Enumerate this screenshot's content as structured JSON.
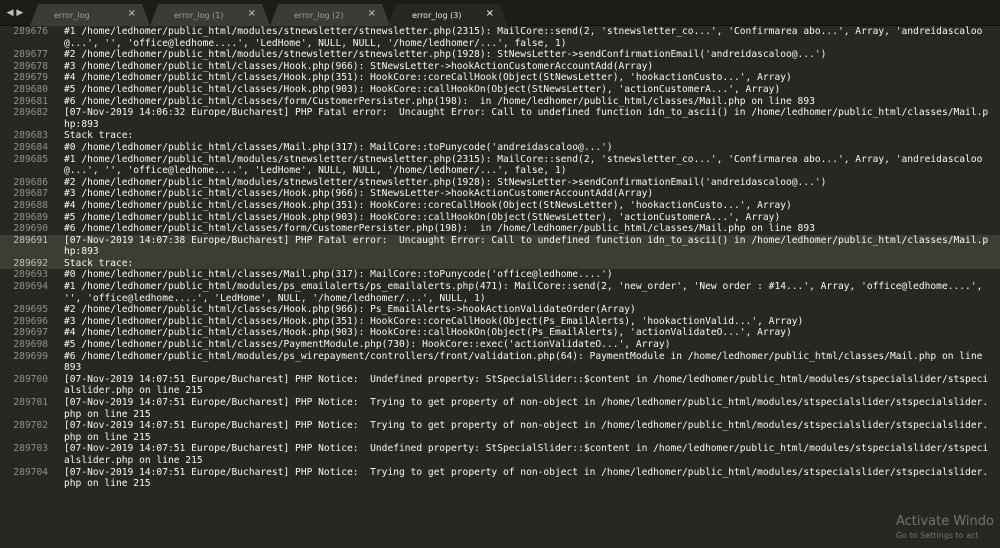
{
  "tabs": [
    {
      "label": "error_log",
      "active": false
    },
    {
      "label": "error_log (1)",
      "active": false
    },
    {
      "label": "error_log (2)",
      "active": false
    },
    {
      "label": "error_log (3)",
      "active": true
    }
  ],
  "tab_close_glyph": "×",
  "nav_arrows": "◀ ▶",
  "highlighted_line": "289691",
  "lines": [
    {
      "n": "289676",
      "text": "#1 /home/ledhomer/public_html/modules/stnewsletter/stnewsletter.php(2315): MailCore::send(2, 'stnewsletter_co...', 'Confirmarea abo...', Array, 'andreidascaloo@...', '', 'office@ledhome....', 'LedHome', NULL, NULL, '/home/ledhomer/...', false, 1)"
    },
    {
      "n": "289677",
      "text": "#2 /home/ledhomer/public_html/modules/stnewsletter/stnewsletter.php(1928): StNewsLetter->sendConfirmationEmail('andreidascaloo@...')"
    },
    {
      "n": "289678",
      "text": "#3 /home/ledhomer/public_html/classes/Hook.php(966): StNewsLetter->hookActionCustomerAccountAdd(Array)"
    },
    {
      "n": "289679",
      "text": "#4 /home/ledhomer/public_html/classes/Hook.php(351): HookCore::coreCallHook(Object(StNewsLetter), 'hookactionCusto...', Array)"
    },
    {
      "n": "289680",
      "text": "#5 /home/ledhomer/public_html/classes/Hook.php(903): HookCore::callHookOn(Object(StNewsLetter), 'actionCustomerA...', Array)"
    },
    {
      "n": "289681",
      "text": "#6 /home/ledhomer/public_html/classes/form/CustomerPersister.php(198):  in /home/ledhomer/public_html/classes/Mail.php on line 893"
    },
    {
      "n": "289682",
      "text": "[07-Nov-2019 14:06:32 Europe/Bucharest] PHP Fatal error:  Uncaught Error: Call to undefined function idn_to_ascii() in /home/ledhomer/public_html/classes/Mail.php:893"
    },
    {
      "n": "289683",
      "text": "Stack trace:"
    },
    {
      "n": "289684",
      "text": "#0 /home/ledhomer/public_html/classes/Mail.php(317): MailCore::toPunycode('andreidascaloo@...')"
    },
    {
      "n": "289685",
      "text": "#1 /home/ledhomer/public_html/modules/stnewsletter/stnewsletter.php(2315): MailCore::send(2, 'stnewsletter_co...', 'Confirmarea abo...', Array, 'andreidascaloo@...', '', 'office@ledhome....', 'LedHome', NULL, NULL, '/home/ledhomer/...', false, 1)"
    },
    {
      "n": "289686",
      "text": "#2 /home/ledhomer/public_html/modules/stnewsletter/stnewsletter.php(1928): StNewsLetter->sendConfirmationEmail('andreidascaloo@...')"
    },
    {
      "n": "289687",
      "text": "#3 /home/ledhomer/public_html/classes/Hook.php(966): StNewsLetter->hookActionCustomerAccountAdd(Array)"
    },
    {
      "n": "289688",
      "text": "#4 /home/ledhomer/public_html/classes/Hook.php(351): HookCore::coreCallHook(Object(StNewsLetter), 'hookactionCusto...', Array)"
    },
    {
      "n": "289689",
      "text": "#5 /home/ledhomer/public_html/classes/Hook.php(903): HookCore::callHookOn(Object(StNewsLetter), 'actionCustomerA...', Array)"
    },
    {
      "n": "289690",
      "text": "#6 /home/ledhomer/public_html/classes/form/CustomerPersister.php(198):  in /home/ledhomer/public_html/classes/Mail.php on line 893"
    },
    {
      "n": "289691",
      "text": "[07-Nov-2019 14:07:38 Europe/Bucharest] PHP Fatal error:  Uncaught Error: Call to undefined function idn_to_ascii() in /home/ledhomer/public_html/classes/Mail.php:893"
    },
    {
      "n": "289692",
      "text": "Stack trace:"
    },
    {
      "n": "289693",
      "text": "#0 /home/ledhomer/public_html/classes/Mail.php(317): MailCore::toPunycode('office@ledhome....')"
    },
    {
      "n": "289694",
      "text": "#1 /home/ledhomer/public_html/modules/ps_emailalerts/ps_emailalerts.php(471): MailCore::send(2, 'new_order', 'New order : #14...', Array, 'office@ledhome....', '', 'office@ledhome....', 'LedHome', NULL, '/home/ledhomer/...', NULL, 1)"
    },
    {
      "n": "289695",
      "text": "#2 /home/ledhomer/public_html/classes/Hook.php(966): Ps_EmailAlerts->hookActionValidateOrder(Array)"
    },
    {
      "n": "289696",
      "text": "#3 /home/ledhomer/public_html/classes/Hook.php(351): HookCore::coreCallHook(Object(Ps_EmailAlerts), 'hookactionValid...', Array)"
    },
    {
      "n": "289697",
      "text": "#4 /home/ledhomer/public_html/classes/Hook.php(903): HookCore::callHookOn(Object(Ps_EmailAlerts), 'actionValidateO...', Array)"
    },
    {
      "n": "289698",
      "text": "#5 /home/ledhomer/public_html/classes/PaymentModule.php(730): HookCore::exec('actionValidateO...', Array)"
    },
    {
      "n": "289699",
      "text": "#6 /home/ledhomer/public_html/modules/ps_wirepayment/controllers/front/validation.php(64): PaymentModule in /home/ledhomer/public_html/classes/Mail.php on line 893"
    },
    {
      "n": "289700",
      "text": "[07-Nov-2019 14:07:51 Europe/Bucharest] PHP Notice:  Undefined property: StSpecialSlider::$content in /home/ledhomer/public_html/modules/stspecialslider/stspecialslider.php on line 215"
    },
    {
      "n": "289701",
      "text": "[07-Nov-2019 14:07:51 Europe/Bucharest] PHP Notice:  Trying to get property of non-object in /home/ledhomer/public_html/modules/stspecialslider/stspecialslider.php on line 215"
    },
    {
      "n": "289702",
      "text": "[07-Nov-2019 14:07:51 Europe/Bucharest] PHP Notice:  Trying to get property of non-object in /home/ledhomer/public_html/modules/stspecialslider/stspecialslider.php on line 215"
    },
    {
      "n": "289703",
      "text": "[07-Nov-2019 14:07:51 Europe/Bucharest] PHP Notice:  Undefined property: StSpecialSlider::$content in /home/ledhomer/public_html/modules/stspecialslider/stspecialslider.php on line 215"
    },
    {
      "n": "289704",
      "text": "[07-Nov-2019 14:07:51 Europe/Bucharest] PHP Notice:  Trying to get property of non-object in /home/ledhomer/public_html/modules/stspecialslider/stspecialslider.php on line 215"
    }
  ],
  "watermark": {
    "title": "Activate Windo",
    "subtitle": "Go to Settings to act"
  }
}
